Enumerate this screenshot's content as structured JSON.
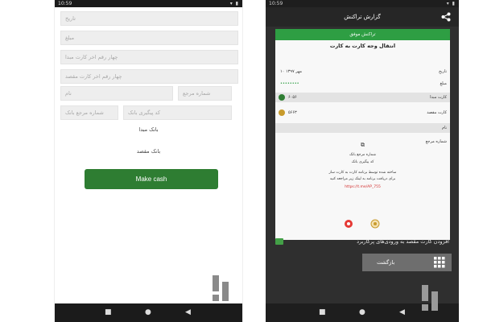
{
  "left": {
    "status": {
      "time": "10:59",
      "icons": "▾ ▮"
    },
    "fields": {
      "date": "تاریخ",
      "amount": "مبلغ",
      "card_src": "چهار رقم اخر کارت مبدا",
      "card_dst": "چهار رقم اخر کارت مقصد",
      "name": "نام",
      "ref_no": "شماره مرجع",
      "bank_ref": "شماره مرجع بانک",
      "tracking": "کد پیگیری بانک"
    },
    "labels": {
      "src_bank": "بانک مبدا",
      "dst_bank": "بانک مقصد"
    },
    "make_cash": "Make cash"
  },
  "right": {
    "status": {
      "time": "10:59",
      "icons": "▾ ▮"
    },
    "title": "گزارش تراکنش",
    "dialog": {
      "success": "تراکنش موفق",
      "heading": "انتقال وجه کارت به کارت",
      "rows": [
        {
          "label": "تاریخ",
          "value": "۱۰ مهر ۱۳۹۷"
        },
        {
          "label": "مبلغ",
          "value": "••••••••"
        },
        {
          "label": "کارت مبدا",
          "value": "۶۰۵۶"
        },
        {
          "label": "کارت مقصد",
          "value": "۵۶۶۳"
        },
        {
          "label": "نام",
          "value": ""
        },
        {
          "label": "شماره مرجع",
          "value": ""
        }
      ],
      "bank_ref": "شماره مرجع بانک",
      "tracking": "کد پیگیری بانک",
      "note1": "ساخته شده توسط برنامه کارت به کارت ساز",
      "note2": "برای دریافت برنامه به لینک زیر مراجعه کنید",
      "link": "https://t.me/AP_755"
    },
    "checkbox_text": "افزودن کارت مقصد به ورودی‌های پرکاربرد",
    "back_button": "بازگشت"
  },
  "colors": {
    "primary_green": "#2e7d32",
    "success_green": "#2e9e43",
    "dark_bg": "#2f2f2f",
    "link_red": "#d32f2f"
  }
}
